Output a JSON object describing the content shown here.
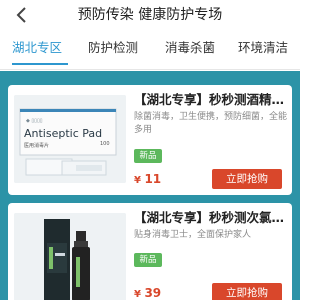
{
  "header": {
    "title": "预防传染 健康防护专场"
  },
  "tabs": [
    {
      "label": "湖北专区",
      "active": true
    },
    {
      "label": "防护检测",
      "active": false
    },
    {
      "label": "消毒杀菌",
      "active": false
    },
    {
      "label": "环境清洁",
      "active": false
    }
  ],
  "products": [
    {
      "title": "【湖北专享】秒秒测酒精消毒湿巾",
      "description": "除菌消毒，卫生便携，预防细菌，全能多用",
      "badge": "新品",
      "currency": "¥",
      "price": "11",
      "buy_label": "立即抢购",
      "image_text": "Antiseptic Pad",
      "image_subtext": "医用消毒片",
      "image_count": "100"
    },
    {
      "title": "【湖北专享】秒秒测次氯酸消毒喷雾",
      "description": "贴身消毒卫士，全面保护家人",
      "badge": "新品",
      "currency": "¥",
      "price": "39",
      "buy_label": "立即抢购"
    }
  ],
  "colors": {
    "accent": "#2d97cf",
    "list_background": "#2c93a7",
    "price": "#d9472b",
    "button": "#d9472b",
    "badge": "#5cb85c"
  }
}
